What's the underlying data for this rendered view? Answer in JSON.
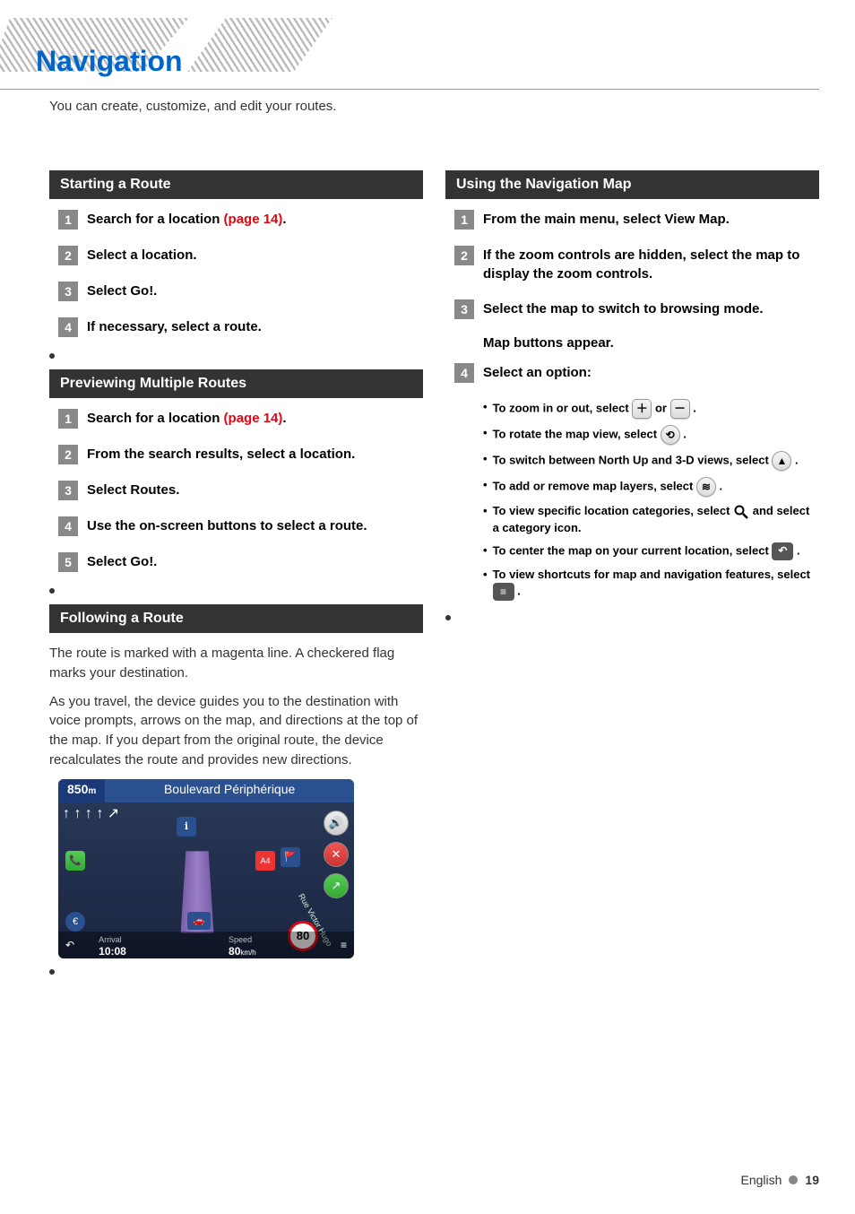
{
  "header": {
    "title": "Navigation",
    "subtitle": "You can create, customize, and edit your routes."
  },
  "left": {
    "starting_route": {
      "heading": "Starting a Route",
      "steps": [
        {
          "n": "1",
          "text": "Search for a location ",
          "link": "(page 14)",
          "suffix": "."
        },
        {
          "n": "2",
          "text": "Select a location."
        },
        {
          "n": "3",
          "text": "Select Go!."
        },
        {
          "n": "4",
          "text": "If necessary, select a route."
        }
      ]
    },
    "preview_routes": {
      "heading": "Previewing Multiple Routes",
      "steps": [
        {
          "n": "1",
          "text": "Search for a location ",
          "link": "(page 14)",
          "suffix": "."
        },
        {
          "n": "2",
          "text": "From the search results, select a location."
        },
        {
          "n": "3",
          "text": "Select Routes."
        },
        {
          "n": "4",
          "text": "Use the on-screen buttons to select a route."
        },
        {
          "n": "5",
          "text": "Select Go!."
        }
      ]
    },
    "following_route": {
      "heading": "Following a Route",
      "para1": "The route is marked with a magenta line. A checkered flag marks your destination.",
      "para2": "As you travel, the device guides you to the destination with voice prompts, arrows on the map, and directions at the top of the map. If you depart from the original route, the device recalculates the route and provides new directions."
    },
    "map": {
      "distance": "850",
      "dist_unit": "m",
      "street": "Boulevard Périphérique",
      "arrows": "↑ ↑ ↑ ↑ ↗",
      "arrival_label": "Arrival",
      "arrival": "10:08",
      "speed_label": "Speed",
      "speed": "80",
      "speed_unit": "km/h",
      "limit": "80"
    }
  },
  "right": {
    "using_nav": {
      "heading": "Using the Navigation Map",
      "steps": [
        {
          "n": "1",
          "text": "From the main menu, select View Map."
        },
        {
          "n": "2",
          "text": "If the zoom controls are hidden, select the map to display the zoom controls."
        },
        {
          "n": "3",
          "text": "Select the map to switch to browsing mode."
        }
      ],
      "note": "Map buttons appear.",
      "step4": {
        "n": "4",
        "text": "Select an option:"
      },
      "bullets": [
        {
          "pre": "To zoom in or out, select ",
          "icon1": "plus",
          "mid": " or ",
          "icon2": "minus",
          "post": "."
        },
        {
          "pre": "To rotate the map view, select ",
          "icon1": "rotate",
          "post": "."
        },
        {
          "pre": "To switch between North Up and 3-D views, select ",
          "icon1": "compass",
          "post": "."
        },
        {
          "pre": "To add or remove map layers, select ",
          "icon1": "layers",
          "post": "."
        },
        {
          "pre": "To view specific location categories, select ",
          "icon1": "search",
          "post": " and select a category icon."
        },
        {
          "pre": "To center the map on your current location, select ",
          "icon1": "back",
          "post": "."
        },
        {
          "pre": "To view shortcuts for map and navigation features, select ",
          "icon1": "menu",
          "post": "."
        }
      ]
    }
  },
  "footer": {
    "lang": "English",
    "page": "19"
  }
}
